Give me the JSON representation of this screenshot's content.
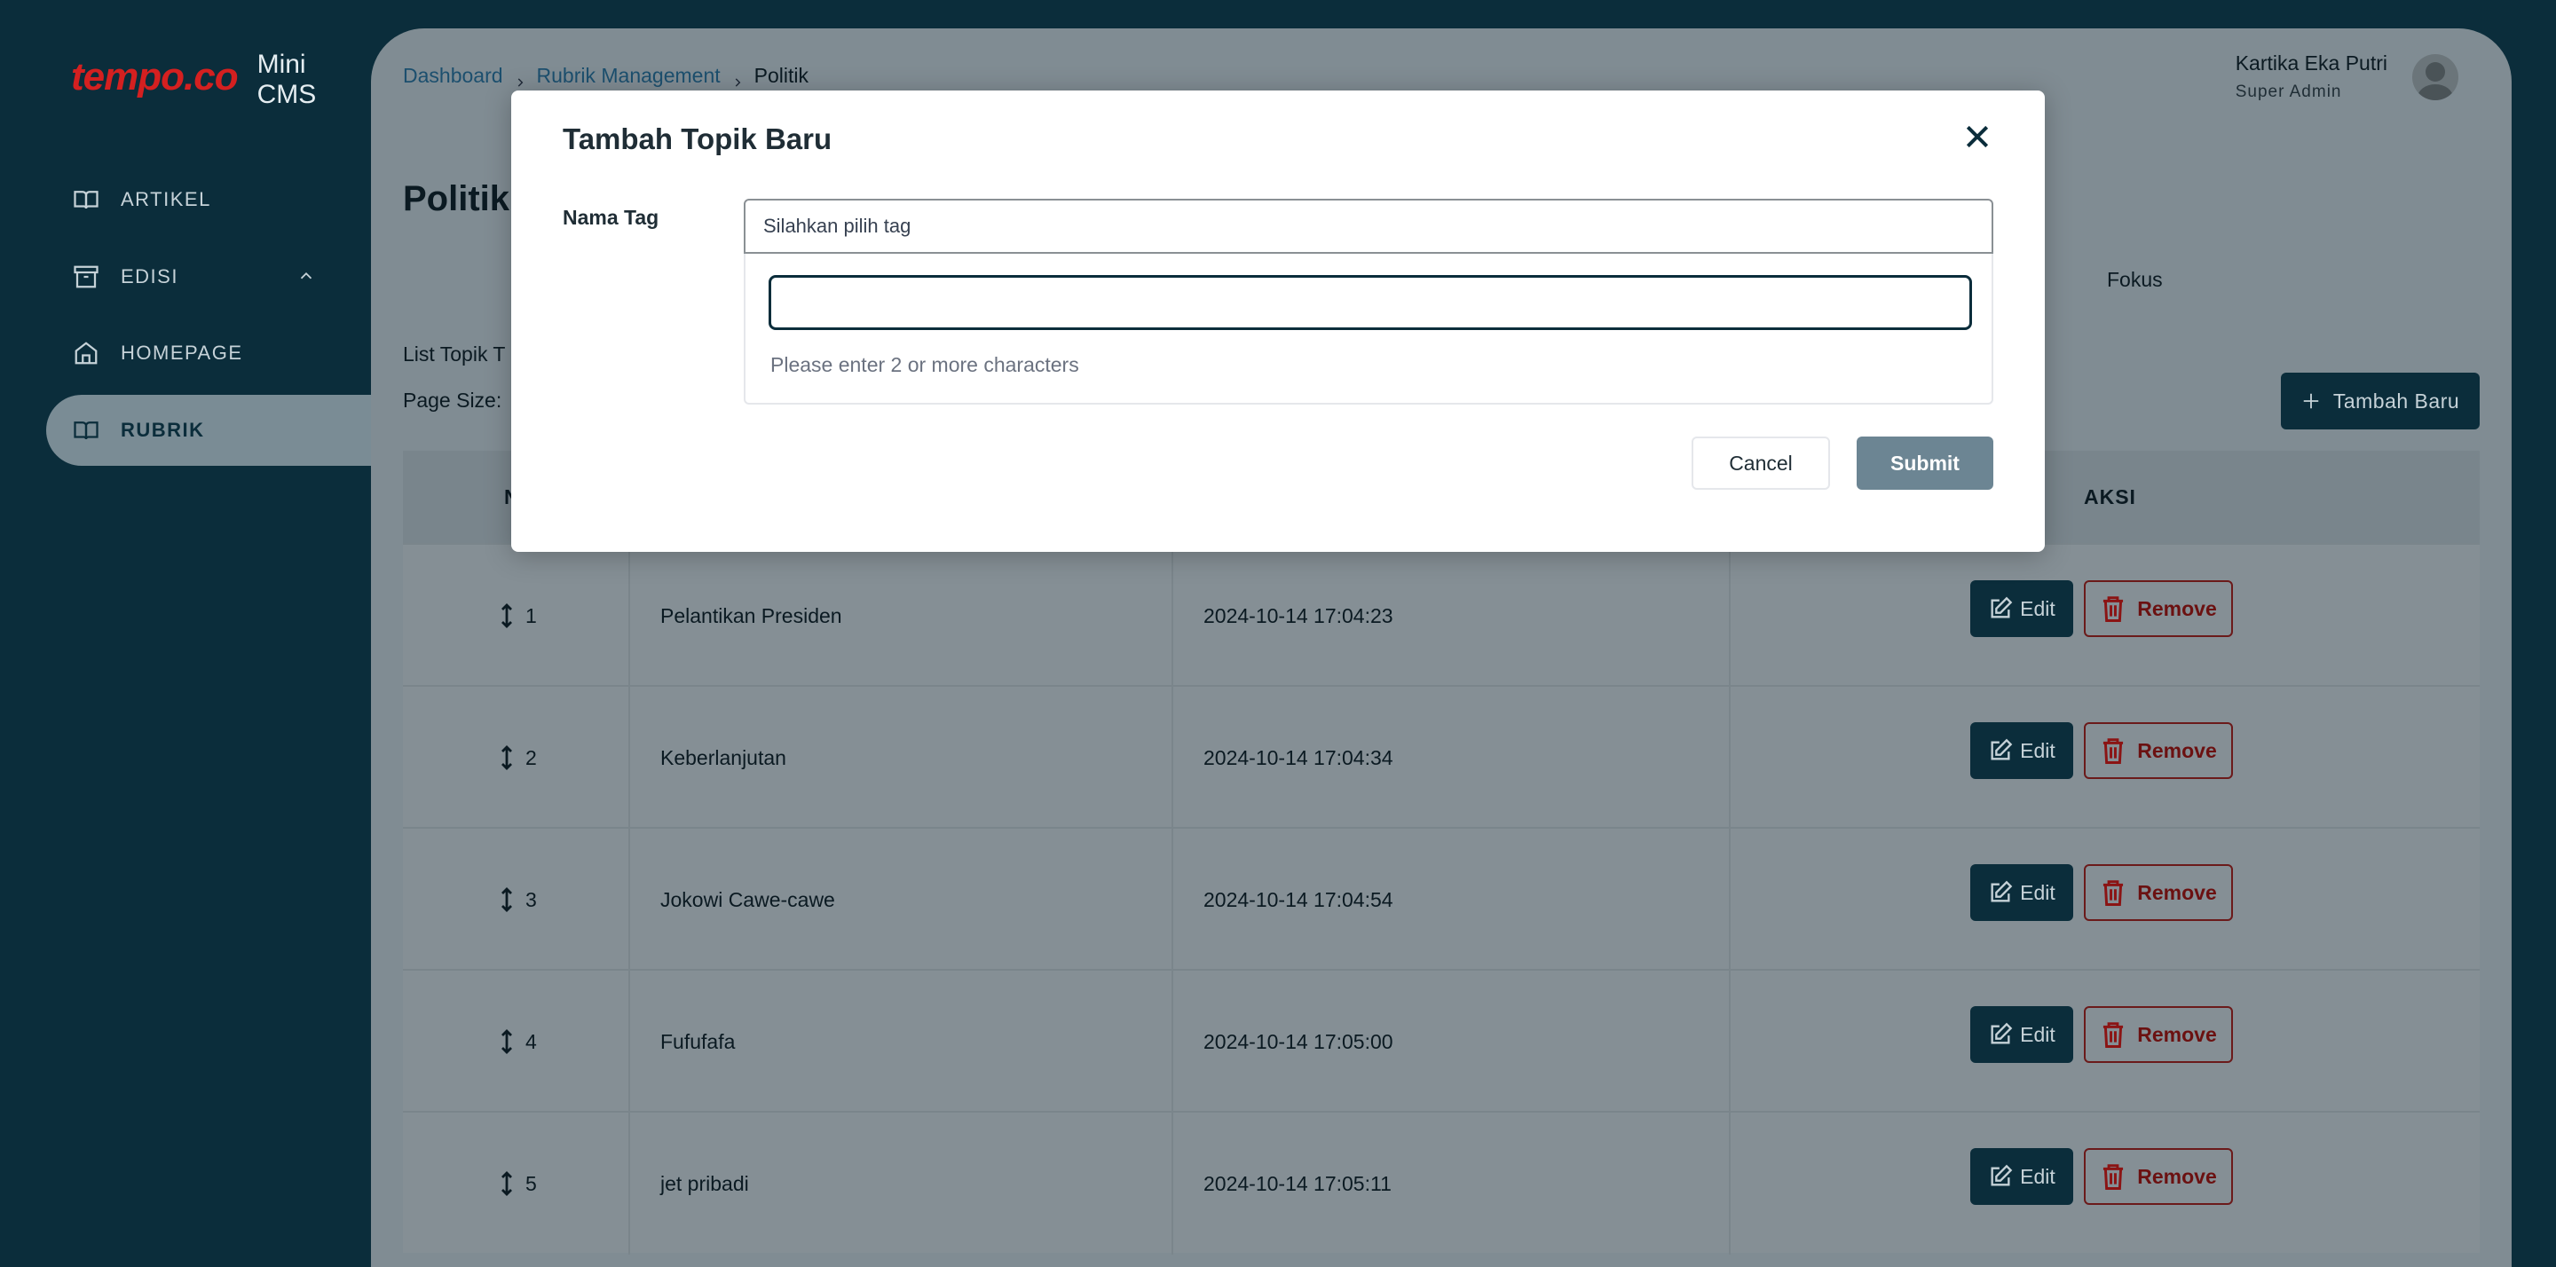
{
  "sidebar": {
    "logo_text": "tempo.co",
    "app_name": "Mini CMS",
    "items": [
      {
        "label": "ARTIKEL",
        "icon": "book-icon"
      },
      {
        "label": "EDISI",
        "icon": "archive-icon"
      },
      {
        "label": "HOMEPAGE",
        "icon": "home-icon"
      },
      {
        "label": "RUBRIK",
        "icon": "book-icon"
      }
    ],
    "active": "RUBRIK"
  },
  "header": {
    "breadcrumb": [
      "Dashboard",
      "Rubrik Management",
      "Politik"
    ],
    "user_name": "Kartika Eka Putri",
    "user_role": "Super Admin"
  },
  "page": {
    "title": "Politik",
    "tab_fokus": "Fokus",
    "list_label": "List Topik T",
    "page_size_label": "Page Size:",
    "add_button": "Tambah Baru"
  },
  "table": {
    "headers": [
      "N",
      "AKSI"
    ],
    "rows": [
      {
        "no": "1",
        "name": "Pelantikan Presiden",
        "date": "2024-10-14 17:04:23"
      },
      {
        "no": "2",
        "name": "Keberlanjutan",
        "date": "2024-10-14 17:04:34"
      },
      {
        "no": "3",
        "name": "Jokowi Cawe-cawe",
        "date": "2024-10-14 17:04:54"
      },
      {
        "no": "4",
        "name": "Fufufafa",
        "date": "2024-10-14 17:05:00"
      },
      {
        "no": "5",
        "name": "jet pribadi",
        "date": "2024-10-14 17:05:11"
      }
    ],
    "edit_label": "Edit",
    "remove_label": "Remove"
  },
  "modal": {
    "title": "Tambah Topik Baru",
    "field_label": "Nama Tag",
    "select_placeholder": "Silahkan pilih tag",
    "search_value": "",
    "hint": "Please enter 2 or more characters",
    "cancel": "Cancel",
    "submit": "Submit"
  },
  "colors": {
    "sidebar_bg": "#0b2d3b",
    "primary": "#0b2d3b",
    "danger": "#8b1414",
    "submit_disabled": "#6c8593"
  }
}
